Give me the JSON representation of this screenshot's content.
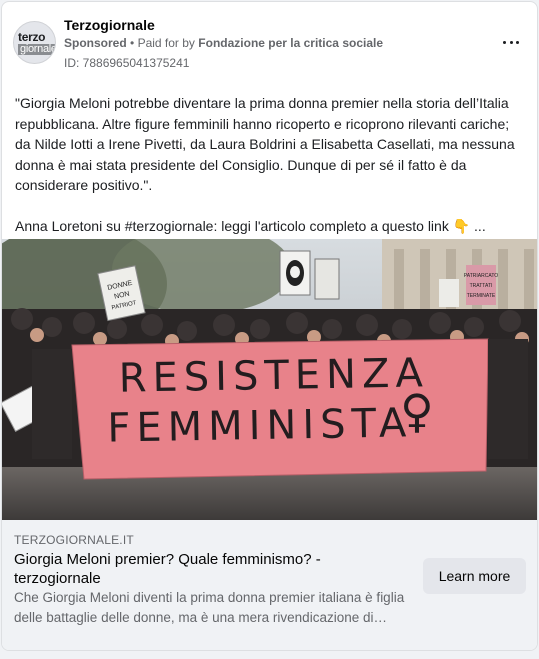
{
  "ad": {
    "page_name": "Terzogiornale",
    "avatar": {
      "line1": "terzo",
      "line2": "giornale"
    },
    "sponsored_label": "Sponsored",
    "separator": "•",
    "paid_for_prefix": "Paid for by",
    "paid_for_org": "Fondazione per la critica sociale",
    "ad_id": "ID: 7886965041375241",
    "more_icon": "more-horizontal-icon"
  },
  "post": {
    "paragraph1": "\"Giorgia Meloni potrebbe diventare la prima donna premier nella storia dell’Italia repubblicana. Altre figure femminili hanno ricoperto e ricoprono rilevanti cariche; da Nilde Iotti a Irene Pivetti, da Laura Boldrini a Elisabetta Casellati, ma nessuna donna è mai stata presidente del Consiglio. Dunque di per sé il fatto è da considerare positivo.\".",
    "paragraph2": "Anna Loretoni su #terzogiornale: leggi l'articolo completo a questo link",
    "pointing_emoji": "👇",
    "see_more": "..."
  },
  "image": {
    "banner_line1": "RESISTENZA",
    "banner_line2": "FEMMINISTA",
    "banner_symbol": "♀",
    "banner_color": "#e8828a",
    "sign1": "DONNE NON PATRIOT",
    "sign2": "PATRIARCATO · TRATTATI · TERMINATE"
  },
  "link": {
    "domain": "TERZOGIORNALE.IT",
    "title": "Giorgia Meloni premier? Quale femminismo? - terzogiornale",
    "description": "Che Giorgia Meloni diventi la prima donna premier italiana è figlia delle battaglie delle donne, ma è una mera rivendicazione di…",
    "cta_label": "Learn more"
  }
}
